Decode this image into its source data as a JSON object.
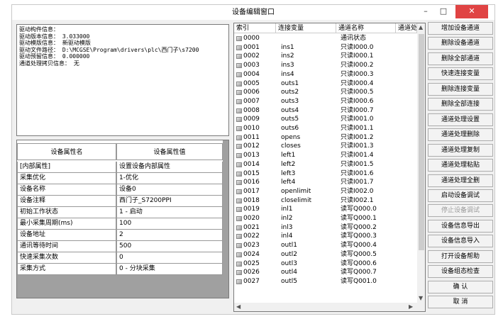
{
  "window": {
    "title": "设备编辑窗口",
    "minimize": "–",
    "maximize": "□",
    "close": "✕"
  },
  "info_lines": [
    "驱动构件信息：",
    "驱动版本信息： 3.033000",
    "驱动模版信息： 新驱动模版",
    "驱动文件路径： D:\\MCGSE\\Program\\drivers\\plc\\西门子\\s7200",
    "驱动预留信息： 0.000000",
    "通道处理拷贝信息： 无"
  ],
  "property_table": {
    "headers": [
      "设备属性名",
      "设备属性值"
    ],
    "rows": [
      [
        "[内部属性]",
        "设置设备内部属性"
      ],
      [
        "采集优化",
        "1-优化"
      ],
      [
        "设备名称",
        "设备0"
      ],
      [
        "设备注释",
        "西门子_S7200PPI"
      ],
      [
        "初始工作状态",
        "1 - 启动"
      ],
      [
        "最小采集周期(ms)",
        "100"
      ],
      [
        "设备地址",
        "2"
      ],
      [
        "通讯等待时间",
        "500"
      ],
      [
        "快速采集次数",
        "0"
      ],
      [
        "采集方式",
        "0 - 分块采集"
      ]
    ]
  },
  "channel_table": {
    "headers": [
      "索引",
      "连接变量",
      "通道名称",
      "通道处理"
    ],
    "rows": [
      [
        "0000",
        "",
        "通讯状态"
      ],
      [
        "0001",
        "ins1",
        "只读I000.0"
      ],
      [
        "0002",
        "ins2",
        "只读I000.1"
      ],
      [
        "0003",
        "ins3",
        "只读I000.2"
      ],
      [
        "0004",
        "ins4",
        "只读I000.3"
      ],
      [
        "0005",
        "outs1",
        "只读I000.4"
      ],
      [
        "0006",
        "outs2",
        "只读I000.5"
      ],
      [
        "0007",
        "outs3",
        "只读I000.6"
      ],
      [
        "0008",
        "outs4",
        "只读I000.7"
      ],
      [
        "0009",
        "outs5",
        "只读I001.0"
      ],
      [
        "0010",
        "outs6",
        "只读I001.1"
      ],
      [
        "0011",
        "opens",
        "只读I001.2"
      ],
      [
        "0012",
        "closes",
        "只读I001.3"
      ],
      [
        "0013",
        "left1",
        "只读I001.4"
      ],
      [
        "0014",
        "left2",
        "只读I001.5"
      ],
      [
        "0015",
        "left3",
        "只读I001.6"
      ],
      [
        "0016",
        "left4",
        "只读I001.7"
      ],
      [
        "0017",
        "openlimit",
        "只读I002.0"
      ],
      [
        "0018",
        "closelimit",
        "只读I002.1"
      ],
      [
        "0019",
        "inl1",
        "读写Q000.0"
      ],
      [
        "0020",
        "inl2",
        "读写Q000.1"
      ],
      [
        "0021",
        "inl3",
        "读写Q000.2"
      ],
      [
        "0022",
        "inl4",
        "读写Q000.3"
      ],
      [
        "0023",
        "outl1",
        "读写Q000.4"
      ],
      [
        "0024",
        "outl2",
        "读写Q000.5"
      ],
      [
        "0025",
        "outl3",
        "读写Q000.6"
      ],
      [
        "0026",
        "outl4",
        "读写Q000.7"
      ],
      [
        "0027",
        "outl5",
        "读写Q001.0"
      ]
    ]
  },
  "buttons": [
    {
      "label": "增加设备通道",
      "enabled": true
    },
    {
      "label": "删除设备通道",
      "enabled": true
    },
    {
      "label": "删除全部通道",
      "enabled": true
    },
    {
      "label": "快速连接变量",
      "enabled": true
    },
    {
      "label": "删除连接变量",
      "enabled": true
    },
    {
      "label": "删除全部连接",
      "enabled": true
    },
    {
      "label": "通道处理设置",
      "enabled": true
    },
    {
      "label": "通道处理删除",
      "enabled": true
    },
    {
      "label": "通道处理复制",
      "enabled": true
    },
    {
      "label": "通道处理粘贴",
      "enabled": true
    },
    {
      "label": "通道处理全删",
      "enabled": true
    },
    {
      "label": "启动设备调试",
      "enabled": true
    },
    {
      "label": "停止设备调试",
      "enabled": false
    },
    {
      "label": "设备信息导出",
      "enabled": true
    },
    {
      "label": "设备信息导入",
      "enabled": true
    },
    {
      "label": "打开设备帮助",
      "enabled": true
    },
    {
      "label": "设备组态检查",
      "enabled": true
    },
    {
      "label": "确          认",
      "enabled": true
    },
    {
      "label": "取          消",
      "enabled": true
    }
  ]
}
